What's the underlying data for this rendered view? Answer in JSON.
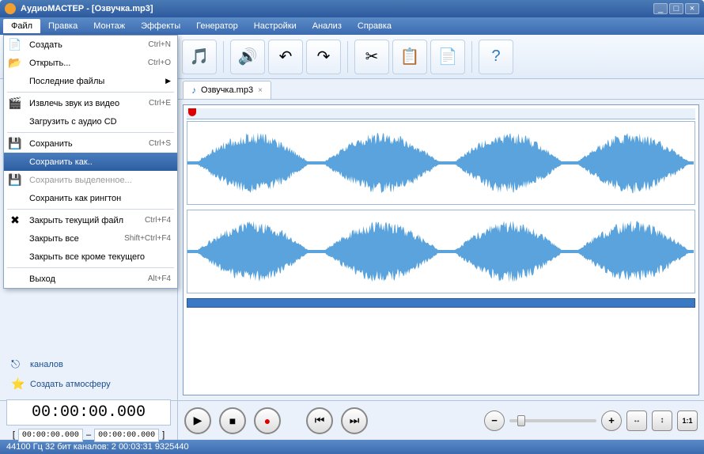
{
  "title": "АудиоМАСТЕР - [Озвучка.mp3]",
  "menubar": [
    "Файл",
    "Правка",
    "Монтаж",
    "Эффекты",
    "Генератор",
    "Настройки",
    "Анализ",
    "Справка"
  ],
  "dropdown": {
    "items": [
      {
        "icon": "📄",
        "label": "Создать",
        "shortcut": "Ctrl+N"
      },
      {
        "icon": "📂",
        "label": "Открыть...",
        "shortcut": "Ctrl+O"
      },
      {
        "icon": "",
        "label": "Последние файлы",
        "shortcut": "",
        "arrow": "▶",
        "sep_after": true
      },
      {
        "icon": "🎬",
        "label": "Извлечь звук из видео",
        "shortcut": "Ctrl+E"
      },
      {
        "icon": "",
        "label": "Загрузить с аудио CD",
        "shortcut": "",
        "sep_after": true
      },
      {
        "icon": "💾",
        "label": "Сохранить",
        "shortcut": "Ctrl+S"
      },
      {
        "icon": "",
        "label": "Сохранить как..",
        "shortcut": "",
        "highlighted": true
      },
      {
        "icon": "💾",
        "label": "Сохранить выделенное...",
        "shortcut": "",
        "disabled": true
      },
      {
        "icon": "",
        "label": "Сохранить как рингтон",
        "shortcut": "",
        "sep_after": true
      },
      {
        "icon": "✖",
        "label": "Закрыть текущий файл",
        "shortcut": "Ctrl+F4"
      },
      {
        "icon": "",
        "label": "Закрыть все",
        "shortcut": "Shift+Ctrl+F4"
      },
      {
        "icon": "",
        "label": "Закрыть все кроме текущего",
        "shortcut": "",
        "sep_after": true
      },
      {
        "icon": "",
        "label": "Выход",
        "shortcut": "Alt+F4"
      }
    ]
  },
  "sidebar": {
    "channels": "каналов",
    "atmosphere": "Создать атмосферу"
  },
  "tab": {
    "label": "Озвучка.mp3"
  },
  "time": {
    "main": "00:00:00.000",
    "start": "00:00:00.000",
    "sep": "–",
    "end": "00:00:00.000"
  },
  "status": "44100 Гц  32 бит  каналов: 2   00:03:31 9325440"
}
